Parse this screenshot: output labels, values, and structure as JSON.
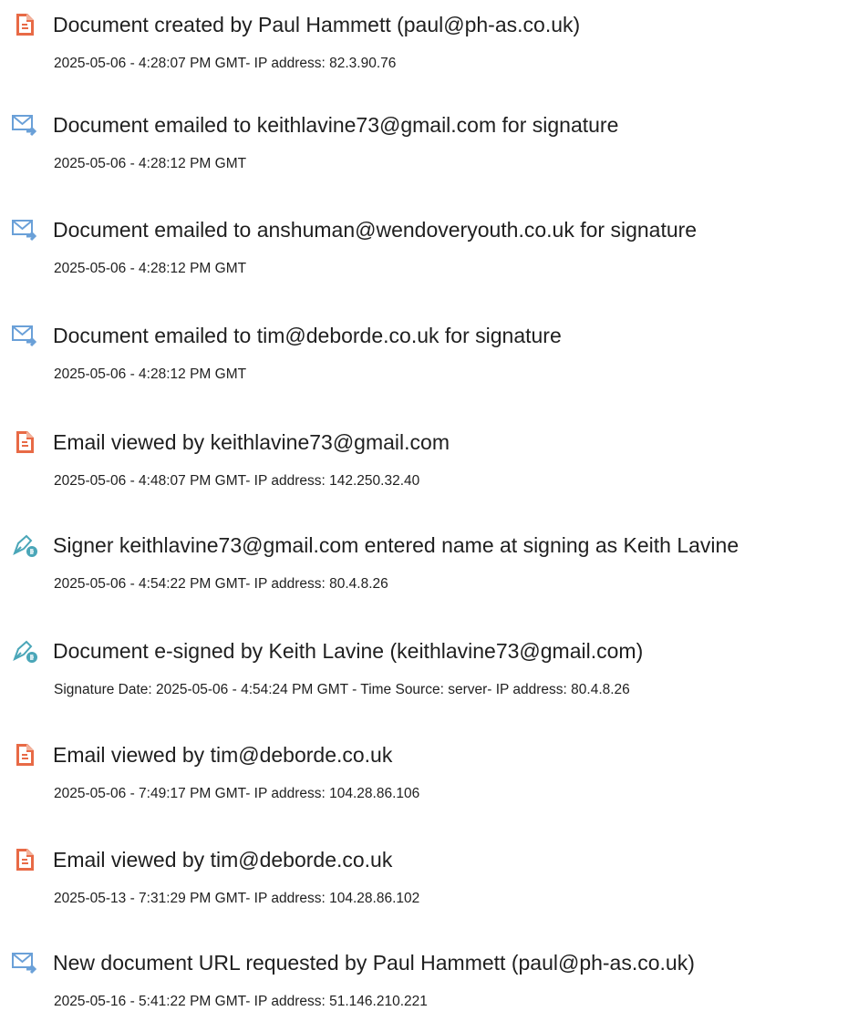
{
  "colors": {
    "document_icon": "#e86a46",
    "email_icon": "#6aa0d8",
    "sign_icon": "#4aa6b8",
    "text": "#1f1f1f"
  },
  "events": [
    {
      "icon": "document-icon",
      "title": "Document created by Paul Hammett (paul@ph-as.co.uk)",
      "detail": "2025-05-06 - 4:28:07 PM GMT- IP address: 82.3.90.76"
    },
    {
      "icon": "email-icon",
      "title": "Document emailed to keithlavine73@gmail.com for signature",
      "detail": "2025-05-06 - 4:28:12 PM GMT"
    },
    {
      "icon": "email-icon",
      "title": "Document emailed to anshuman@wendoveryouth.co.uk for signature",
      "detail": "2025-05-06 - 4:28:12 PM GMT"
    },
    {
      "icon": "email-icon",
      "title": "Document emailed to tim@deborde.co.uk for signature",
      "detail": "2025-05-06 - 4:28:12 PM GMT"
    },
    {
      "icon": "document-icon",
      "title": "Email viewed by keithlavine73@gmail.com",
      "detail": "2025-05-06 - 4:48:07 PM GMT- IP address: 142.250.32.40"
    },
    {
      "icon": "sign-pen-icon",
      "title": "Signer keithlavine73@gmail.com entered name at signing as Keith Lavine",
      "detail": "2025-05-06 - 4:54:22 PM GMT- IP address: 80.4.8.26"
    },
    {
      "icon": "sign-pen-icon",
      "title": "Document e-signed by Keith Lavine (keithlavine73@gmail.com)",
      "detail": "Signature Date: 2025-05-06 - 4:54:24 PM GMT - Time Source: server- IP address: 80.4.8.26"
    },
    {
      "icon": "document-icon",
      "title": "Email viewed by tim@deborde.co.uk",
      "detail": "2025-05-06 - 7:49:17 PM GMT- IP address: 104.28.86.106"
    },
    {
      "icon": "document-icon",
      "title": "Email viewed by tim@deborde.co.uk",
      "detail": "2025-05-13 - 7:31:29 PM GMT- IP address: 104.28.86.102"
    },
    {
      "icon": "email-icon",
      "title": "New document URL requested by Paul Hammett (paul@ph-as.co.uk)",
      "detail": "2025-05-16 - 5:41:22 PM GMT- IP address: 51.146.210.221"
    }
  ]
}
